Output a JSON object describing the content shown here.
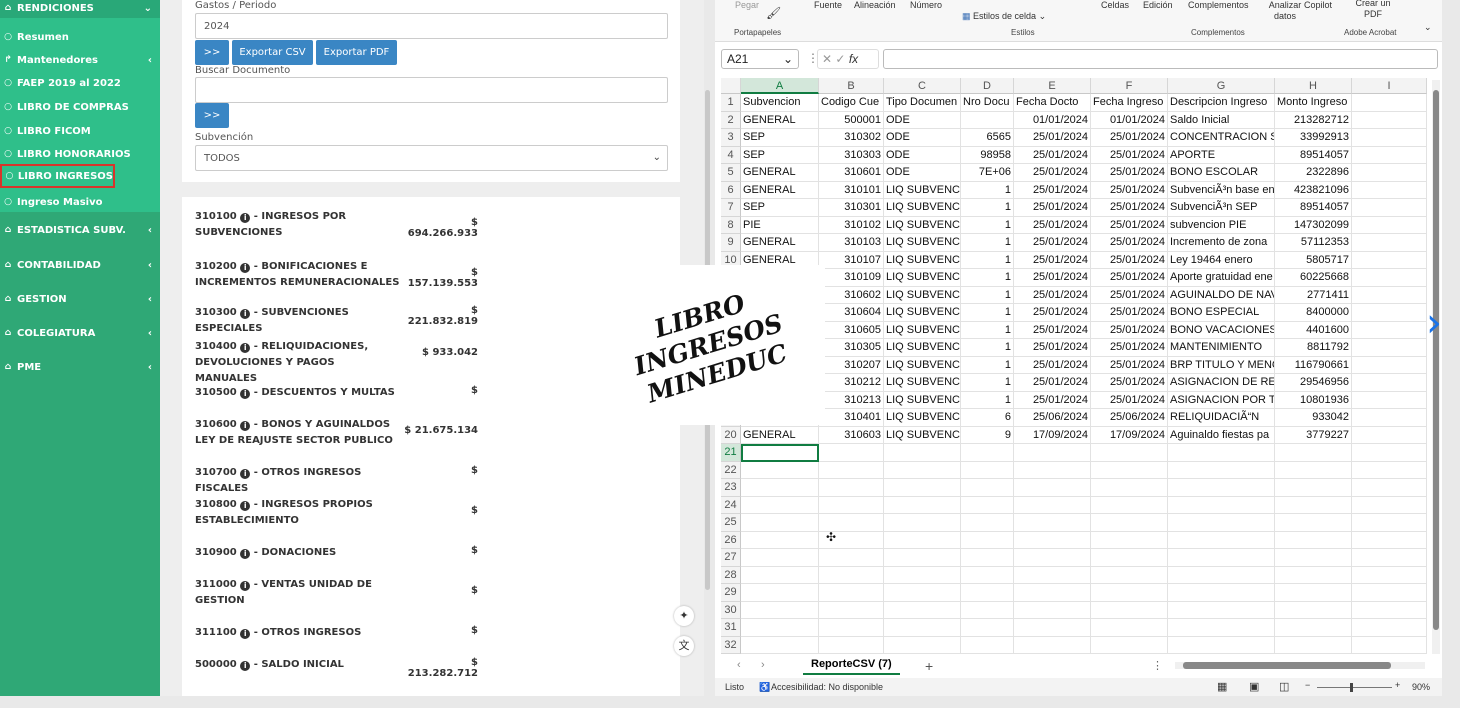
{
  "sidebar": {
    "items": [
      {
        "label": "RENDICIONES",
        "icon": "home-icon",
        "chev": "⌄"
      },
      {
        "label": "Resumen",
        "icon": "circle-icon"
      },
      {
        "label": "Mantenedores",
        "icon": "share-icon",
        "chev": "‹"
      },
      {
        "label": "FAEP 2019 al 2022",
        "icon": "circle-icon"
      },
      {
        "label": "LIBRO DE COMPRAS",
        "icon": "circle-icon"
      },
      {
        "label": "LIBRO FICOM",
        "icon": "circle-icon"
      },
      {
        "label": "LIBRO HONORARIOS",
        "icon": "circle-icon"
      },
      {
        "label": "LIBRO INGRESOS",
        "icon": "circle-icon"
      },
      {
        "label": "Ingreso Masivo",
        "icon": "circle-icon"
      },
      {
        "label": "ESTADISTICA SUBV.",
        "icon": "home-icon",
        "chev": "‹"
      },
      {
        "label": "CONTABILIDAD",
        "icon": "home-icon",
        "chev": "‹"
      },
      {
        "label": "GESTION",
        "icon": "home-icon",
        "chev": "‹"
      },
      {
        "label": "COLEGIATURA",
        "icon": "home-icon",
        "chev": "‹"
      },
      {
        "label": "PME",
        "icon": "home-icon",
        "chev": "‹"
      }
    ]
  },
  "filters": {
    "period_label": "Gastos / Periodo",
    "period_value": "2024",
    "go_label": ">>",
    "export_csv": "Exportar CSV",
    "export_pdf": "Exportar PDF",
    "search_label": "Buscar Documento",
    "search_go": ">>",
    "subv_label": "Subvención",
    "subv_value": "TODOS"
  },
  "accounts": [
    {
      "code": "310100",
      "name": "- INGRESOS POR SUBVENCIONES",
      "amount": "$ 694.266.933"
    },
    {
      "code": "310200",
      "name": "- BONIFICACIONES E INCREMENTOS REMUNERACIONALES",
      "amount": "$ 157.139.553"
    },
    {
      "code": "310300",
      "name": "- SUBVENCIONES ESPECIALES",
      "amount": "$ 221.832.819"
    },
    {
      "code": "310400",
      "name": "- RELIQUIDACIONES, DEVOLUCIONES Y PAGOS MANUALES",
      "amount": "$ 933.042"
    },
    {
      "code": "310500",
      "name": "- DESCUENTOS Y MULTAS",
      "amount": "$"
    },
    {
      "code": "310600",
      "name": "- BONOS Y AGUINALDOS LEY DE REAJUSTE SECTOR PUBLICO",
      "amount": "$ 21.675.134"
    },
    {
      "code": "310700",
      "name": "- OTROS INGRESOS FISCALES",
      "amount": "$"
    },
    {
      "code": "310800",
      "name": "- INGRESOS PROPIOS ESTABLECIMIENTO",
      "amount": "$"
    },
    {
      "code": "310900",
      "name": "- DONACIONES",
      "amount": "$"
    },
    {
      "code": "311000",
      "name": "- VENTAS UNIDAD DE GESTION",
      "amount": "$"
    },
    {
      "code": "311100",
      "name": "- OTROS INGRESOS",
      "amount": "$"
    },
    {
      "code": "500000",
      "name": "- SALDO INICIAL",
      "amount": "$ 213.282.712"
    }
  ],
  "watermark": {
    "line1": "LIBRO INGRESOS",
    "line2": "MINEDUC"
  },
  "excel": {
    "ribbon": {
      "paste": "Pegar",
      "font": "Fuente",
      "align": "Alineación",
      "number": "Número",
      "cell_styles": "Estilos de celda",
      "cells": "Celdas",
      "edit": "Edición",
      "addins": "Complementos",
      "analyze": "Analizar datos",
      "copilot": "Copilot",
      "create_pdf": "Crear un PDF",
      "grp_clipboard": "Portapapeles",
      "grp_styles": "Estilos",
      "grp_addins": "Complementos",
      "grp_acrobat": "Adobe Acrobat"
    },
    "namebox": "A21",
    "fx": "fx",
    "columns": [
      "A",
      "B",
      "C",
      "D",
      "E",
      "F",
      "G",
      "H",
      "I"
    ],
    "headers": [
      "Subvencion",
      "Codigo Cue",
      "Tipo Documen",
      "Nro Docu",
      "Fecha Docto",
      "Fecha Ingreso",
      "Descripcion Ingreso",
      "Monto Ingreso",
      ""
    ],
    "rows": [
      [
        "GENERAL",
        "500001",
        "ODE",
        "",
        "01/01/2024",
        "01/01/2024",
        "Saldo Inicial",
        "213282712"
      ],
      [
        "SEP",
        "310302",
        "ODE",
        "6565",
        "25/01/2024",
        "25/01/2024",
        "CONCENTRACION S",
        "33992913"
      ],
      [
        "SEP",
        "310303",
        "ODE",
        "98958",
        "25/01/2024",
        "25/01/2024",
        "APORTE",
        "89514057"
      ],
      [
        "GENERAL",
        "310601",
        "ODE",
        "7E+06",
        "25/01/2024",
        "25/01/2024",
        "BONO ESCOLAR",
        "2322896"
      ],
      [
        "GENERAL",
        "310101",
        "LIQ SUBVENCI",
        "1",
        "25/01/2024",
        "25/01/2024",
        "SubvenciÃ³n base en",
        "423821096"
      ],
      [
        "SEP",
        "310301",
        "LIQ SUBVENCI",
        "1",
        "25/01/2024",
        "25/01/2024",
        "SubvenciÃ³n SEP",
        "89514057"
      ],
      [
        "PIE",
        "310102",
        "LIQ SUBVENCI",
        "1",
        "25/01/2024",
        "25/01/2024",
        "subvencion PIE",
        "147302099"
      ],
      [
        "GENERAL",
        "310103",
        "LIQ SUBVENCI",
        "1",
        "25/01/2024",
        "25/01/2024",
        "Incremento de zona",
        "57112353"
      ],
      [
        "GENERAL",
        "310107",
        "LIQ SUBVENCI",
        "1",
        "25/01/2024",
        "25/01/2024",
        "Ley 19464 enero",
        "5805717"
      ],
      [
        "",
        "310109",
        "LIQ SUBVENCI",
        "1",
        "25/01/2024",
        "25/01/2024",
        "Aporte gratuidad ene",
        "60225668"
      ],
      [
        "",
        "310602",
        "LIQ SUBVENCI",
        "1",
        "25/01/2024",
        "25/01/2024",
        "AGUINALDO DE NAV",
        "2771411"
      ],
      [
        "",
        "310604",
        "LIQ SUBVENCI",
        "1",
        "25/01/2024",
        "25/01/2024",
        "BONO ESPECIAL",
        "8400000"
      ],
      [
        "",
        "310605",
        "LIQ SUBVENCI",
        "1",
        "25/01/2024",
        "25/01/2024",
        "BONO VACACIONES",
        "4401600"
      ],
      [
        "",
        "310305",
        "LIQ SUBVENCI",
        "1",
        "25/01/2024",
        "25/01/2024",
        "MANTENIMIENTO",
        "8811792"
      ],
      [
        "",
        "310207",
        "LIQ SUBVENCI",
        "1",
        "25/01/2024",
        "25/01/2024",
        "BRP TITULO Y MENCI",
        "116790661"
      ],
      [
        "",
        "310212",
        "LIQ SUBVENCI",
        "1",
        "25/01/2024",
        "25/01/2024",
        "ASIGNACION DE RE",
        "29546956"
      ],
      [
        "",
        "310213",
        "LIQ SUBVENCI",
        "1",
        "25/01/2024",
        "25/01/2024",
        "ASIGNACION POR TF",
        "10801936"
      ],
      [
        "GENERAL",
        "310401",
        "LIQ SUBVENCI",
        "6",
        "25/06/2024",
        "25/06/2024",
        "RELIQUIDACIÃ“N",
        "933042"
      ],
      [
        "GENERAL",
        "310603",
        "LIQ SUBVENCI",
        "9",
        "17/09/2024",
        "17/09/2024",
        "Aguinaldo fiestas pa",
        "3779227"
      ]
    ],
    "row_numbers": [
      "1",
      "2",
      "3",
      "4",
      "5",
      "6",
      "7",
      "8",
      "9",
      "10",
      "11",
      "12",
      "13",
      "14",
      "15",
      "16",
      "17",
      "18",
      "19",
      "20",
      "21",
      "22",
      "23",
      "24",
      "25",
      "26",
      "27",
      "28",
      "29",
      "30",
      "31",
      "32"
    ],
    "sheet_tab": "ReporteCSV (7)",
    "add_sheet": "+",
    "status_ready": "Listo",
    "status_access": "Accesibilidad: No disponible",
    "zoom": "90%"
  }
}
